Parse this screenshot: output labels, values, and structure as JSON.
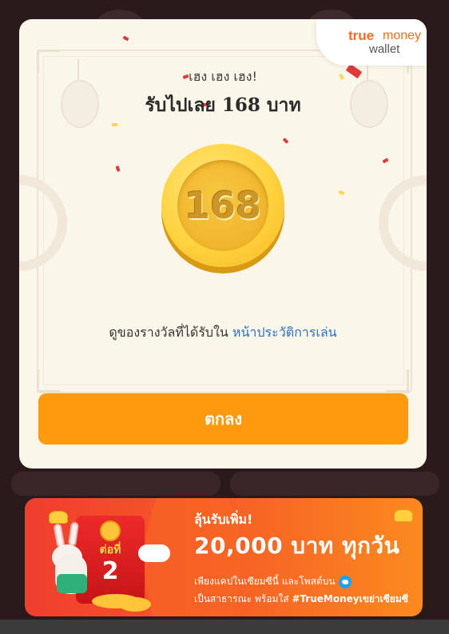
{
  "modal": {
    "brand": {
      "true": "true",
      "money": "money",
      "wallet": "wallet"
    },
    "greeting": "เฮง เฮง เฮง!",
    "title": "รับไปเลย 168 บาท",
    "coin_value": "168",
    "history_text": "ดูของรางวัลที่ได้รับใน",
    "history_link": "หน้าประวัติการเล่น",
    "ok_button": "ตกลง"
  },
  "banner": {
    "envelope_label": "ต่อที่",
    "envelope_number": "2",
    "headline": "ลุ้นรับเพิ่ม!",
    "amount": "20,000 บาท ทุกวัน",
    "line1": "เพียงแคปในเซียมซีนี้ และโพสต์บน",
    "line2_prefix": "เป็นสาธารณะ พร้อมใส่",
    "hashtag": "#TrueMoneyเขย่าเซียมซี"
  },
  "colors": {
    "accent_orange": "#ff9a0f",
    "link_blue": "#2a6fc9",
    "brand_orange": "#f36b21"
  }
}
